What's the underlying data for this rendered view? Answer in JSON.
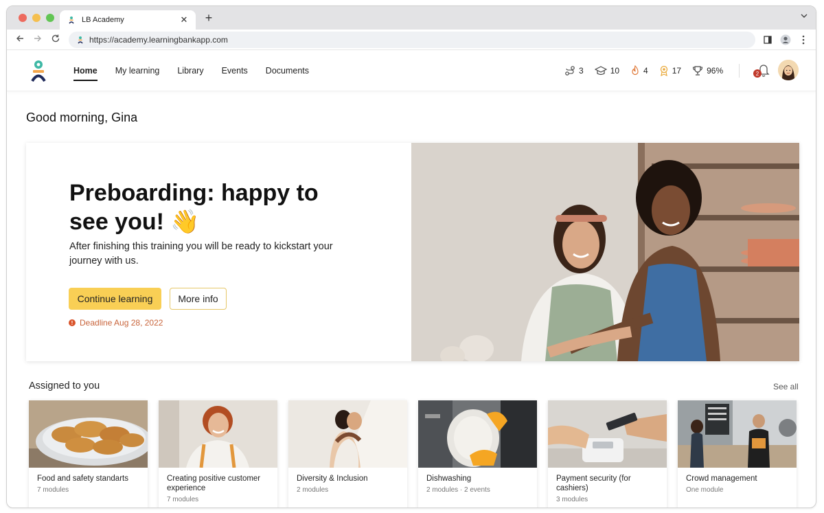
{
  "browser": {
    "tab_title": "LB Academy",
    "tab_close": "✕",
    "new_tab": "+",
    "url": "https://academy.learningbankapp.com"
  },
  "nav": {
    "items": [
      "Home",
      "My learning",
      "Library",
      "Events",
      "Documents"
    ],
    "active": "Home"
  },
  "stats": {
    "streak": "3",
    "courses": "10",
    "fire": "4",
    "badges": "17",
    "score": "96%"
  },
  "notifications": {
    "count": "2"
  },
  "greeting": "Good morning, Gina",
  "hero": {
    "title": "Preboarding: happy to see you! 👋",
    "description": "After finishing this training you will be ready to kickstart your journey with us.",
    "primary_button": "Continue learning",
    "secondary_button": "More info",
    "deadline": "Deadline Aug 28, 2022"
  },
  "assigned": {
    "title": "Assigned to you",
    "see_all": "See all",
    "cards": [
      {
        "title": "Food and safety standarts",
        "meta": "7 modules"
      },
      {
        "title": "Creating positive customer experience",
        "meta": "7 modules"
      },
      {
        "title": "Diversity & Inclusion",
        "meta": "2 modules"
      },
      {
        "title": "Dishwashing",
        "meta": "2 modules · 2 events"
      },
      {
        "title": "Payment security (for cashiers)",
        "meta": "3 modules"
      },
      {
        "title": "Crowd management",
        "meta": "One module"
      }
    ]
  },
  "colors": {
    "accent": "#f9cf55",
    "deadline": "#c8643b",
    "badge": "#c0392b",
    "logo_teal": "#3fb8a5",
    "logo_orange": "#f3a64b",
    "logo_navy": "#1f2a5a"
  }
}
